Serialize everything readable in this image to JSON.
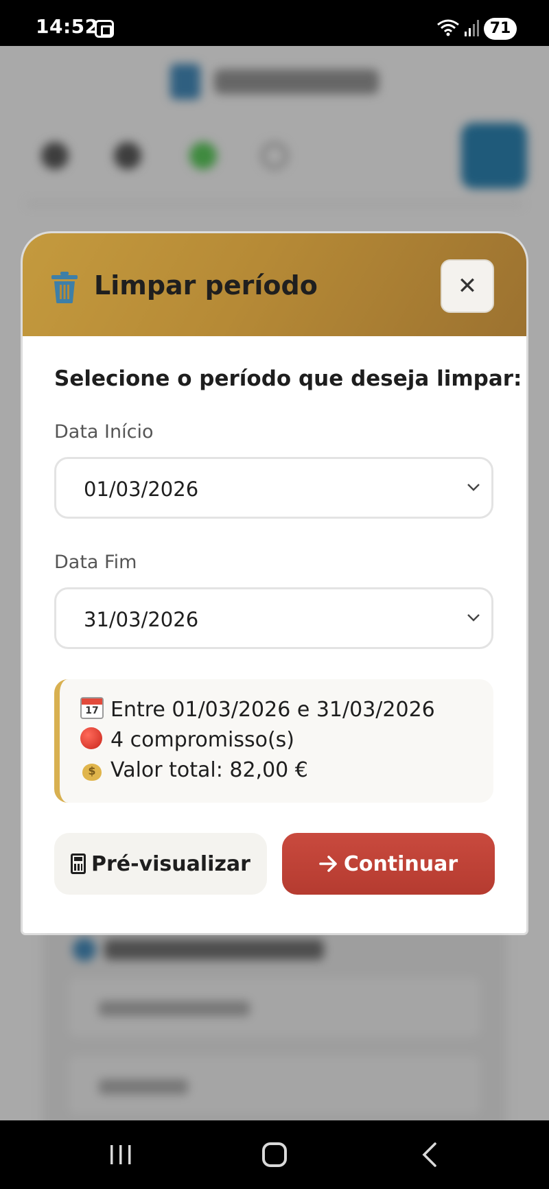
{
  "status_bar": {
    "time": "14:52",
    "battery": "71"
  },
  "modal": {
    "title": "Limpar período",
    "close_label": "✕",
    "subtitle": "Selecione o período que deseja limpar:",
    "start_label": "Data Início",
    "start_value": "01/03/2026",
    "end_label": "Data Fim",
    "end_value": "31/03/2026",
    "summary": {
      "range_text": "Entre 01/03/2026 e 31/03/2026",
      "count_text": "4 compromisso(s)",
      "total_text": "Valor total: 82,00 €"
    },
    "preview_label": "Pré-visualizar",
    "continue_label": "Continuar"
  },
  "colors": {
    "header_gold": "#b68a36",
    "continue_red": "#b53b30",
    "summary_border": "#d8b050"
  },
  "icons": [
    "trash-icon",
    "close-icon",
    "chevron-down-icon",
    "calendar-icon",
    "red-circle-icon",
    "money-bag-icon",
    "calculator-icon",
    "arrow-right-icon"
  ]
}
